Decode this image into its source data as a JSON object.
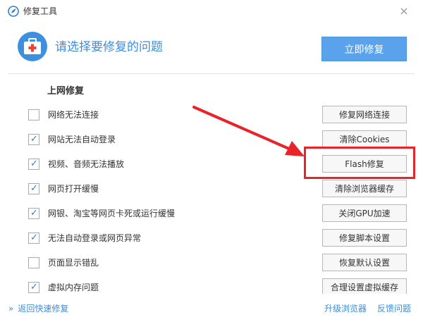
{
  "window": {
    "title": "修复工具",
    "close_glyph": "×",
    "logo_icon": "browser-logo-icon"
  },
  "header": {
    "title": "请选择要修复的问题",
    "icon": "first-aid-kit-icon",
    "repair_now_label": "立即修复"
  },
  "section": {
    "title": "上网修复"
  },
  "items": [
    {
      "label": "网络无法连接",
      "checked": false,
      "button": "修复网络连接"
    },
    {
      "label": "网站无法自动登录",
      "checked": true,
      "button": "清除Cookies"
    },
    {
      "label": "视频、音频无法播放",
      "checked": true,
      "button": "Flash修复"
    },
    {
      "label": "网页打开缓慢",
      "checked": true,
      "button": "清除浏览器缓存"
    },
    {
      "label": "网银、淘宝等网页卡死或运行缓慢",
      "checked": true,
      "button": "关闭GPU加速"
    },
    {
      "label": "无法自动登录或网页异常",
      "checked": true,
      "button": "修复脚本设置"
    },
    {
      "label": "页面显示错乱",
      "checked": false,
      "button": "恢复默认设置"
    },
    {
      "label": "虚拟内存问题",
      "checked": true,
      "button": "合理设置虚拟缓存"
    }
  ],
  "footer": {
    "back_glyph": "»",
    "back_label": "返回快速修复",
    "upgrade_label": "升级浏览器",
    "feedback_label": "反馈问题"
  },
  "colors": {
    "accent": "#3a8ddf",
    "button_primary": "#5aa3ec",
    "annotation_red": "#e8232a",
    "check": "#2f7fd6"
  }
}
